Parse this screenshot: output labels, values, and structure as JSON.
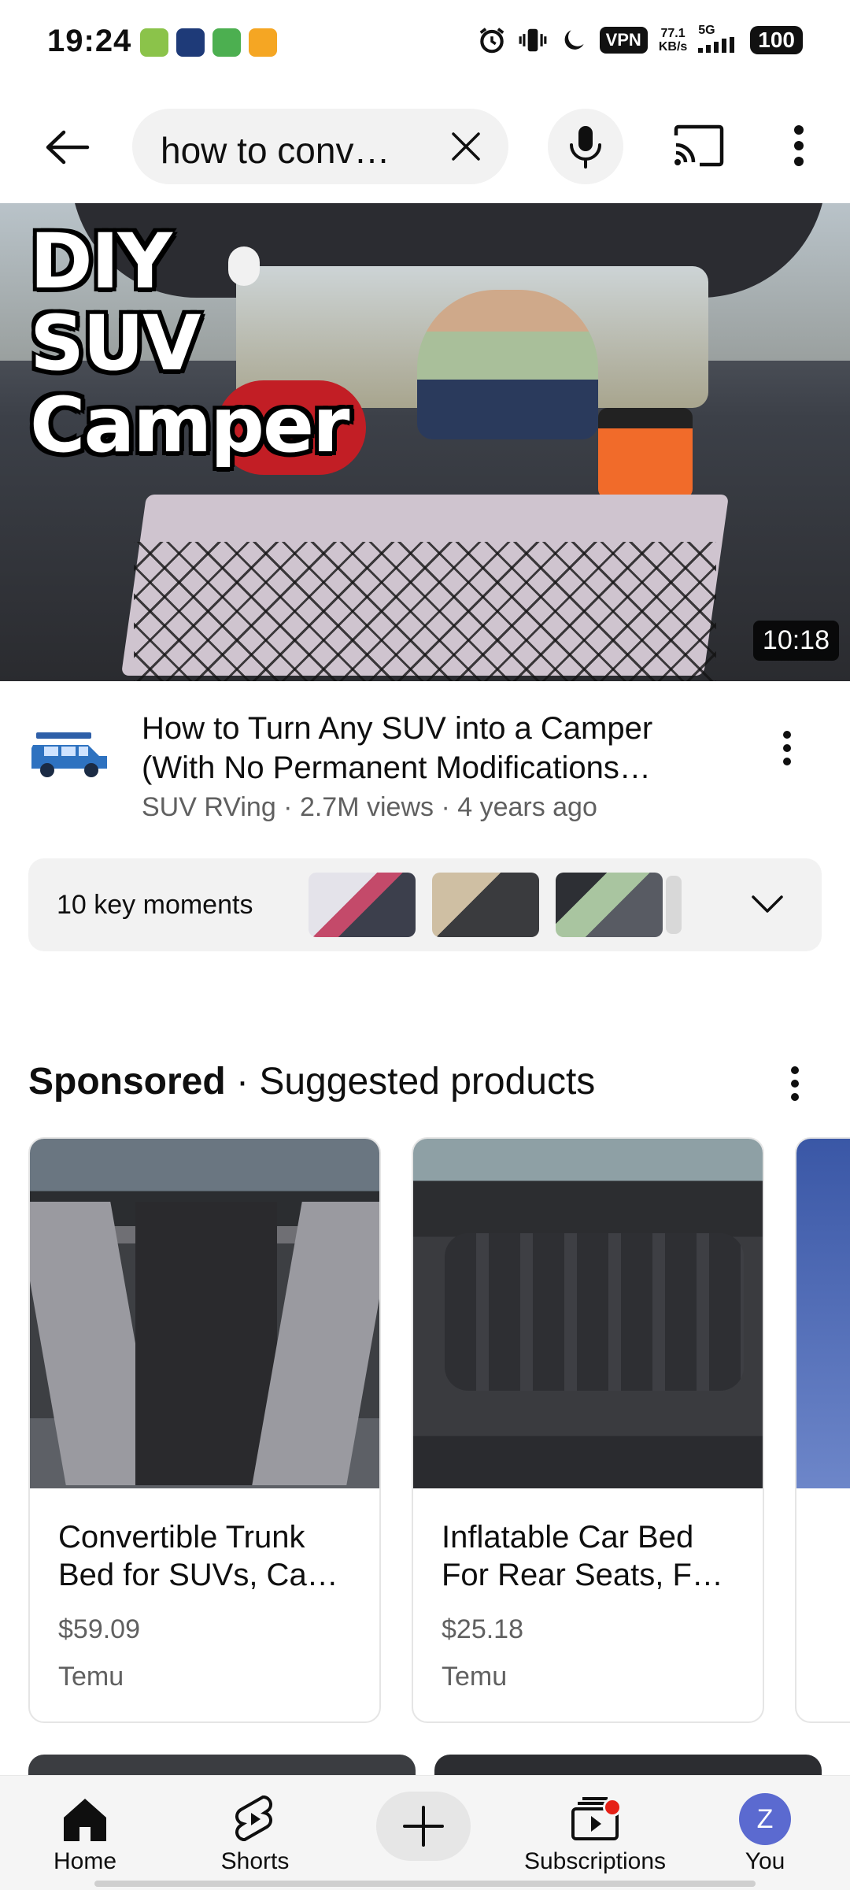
{
  "status_bar": {
    "time": "19:24",
    "vpn": "VPN",
    "speed_value": "77.1",
    "speed_unit": "KB/s",
    "network": "5G",
    "battery": "100",
    "app_icon_colors": [
      "#8bc34a",
      "#1e3a78",
      "#4caf50",
      "#f5a623"
    ]
  },
  "search": {
    "query": "how to conv…"
  },
  "video": {
    "thumbnail_title_lines": [
      "DIY",
      "SUV",
      "Camper"
    ],
    "duration": "10:18",
    "title_line1": "How to Turn Any SUV into a Camper",
    "title_line2": "(With No Permanent Modifications…",
    "subtitle": "SUV RVing · 2.7M views · 4 years ago"
  },
  "key_moments": {
    "label": "10 key moments"
  },
  "sponsored": {
    "label_strong": "Sponsored",
    "label_rest": " · Suggested products"
  },
  "products": [
    {
      "name_line1": "Convertible Trunk",
      "name_line2": "Bed for SUVs, Ca…",
      "price": "$59.09",
      "store": "Temu"
    },
    {
      "name_line1": "Inflatable Car Bed",
      "name_line2": "For Rear Seats, F…",
      "price": "$25.18",
      "store": "Temu"
    }
  ],
  "bottom_nav": {
    "home": "Home",
    "shorts": "Shorts",
    "subscriptions": "Subscriptions",
    "you": "You",
    "you_initial": "Z"
  },
  "colors": {
    "accent_red": "#e62117",
    "avatar_blue": "#5b6ad0",
    "orange_power_station": "#f16b2a"
  }
}
